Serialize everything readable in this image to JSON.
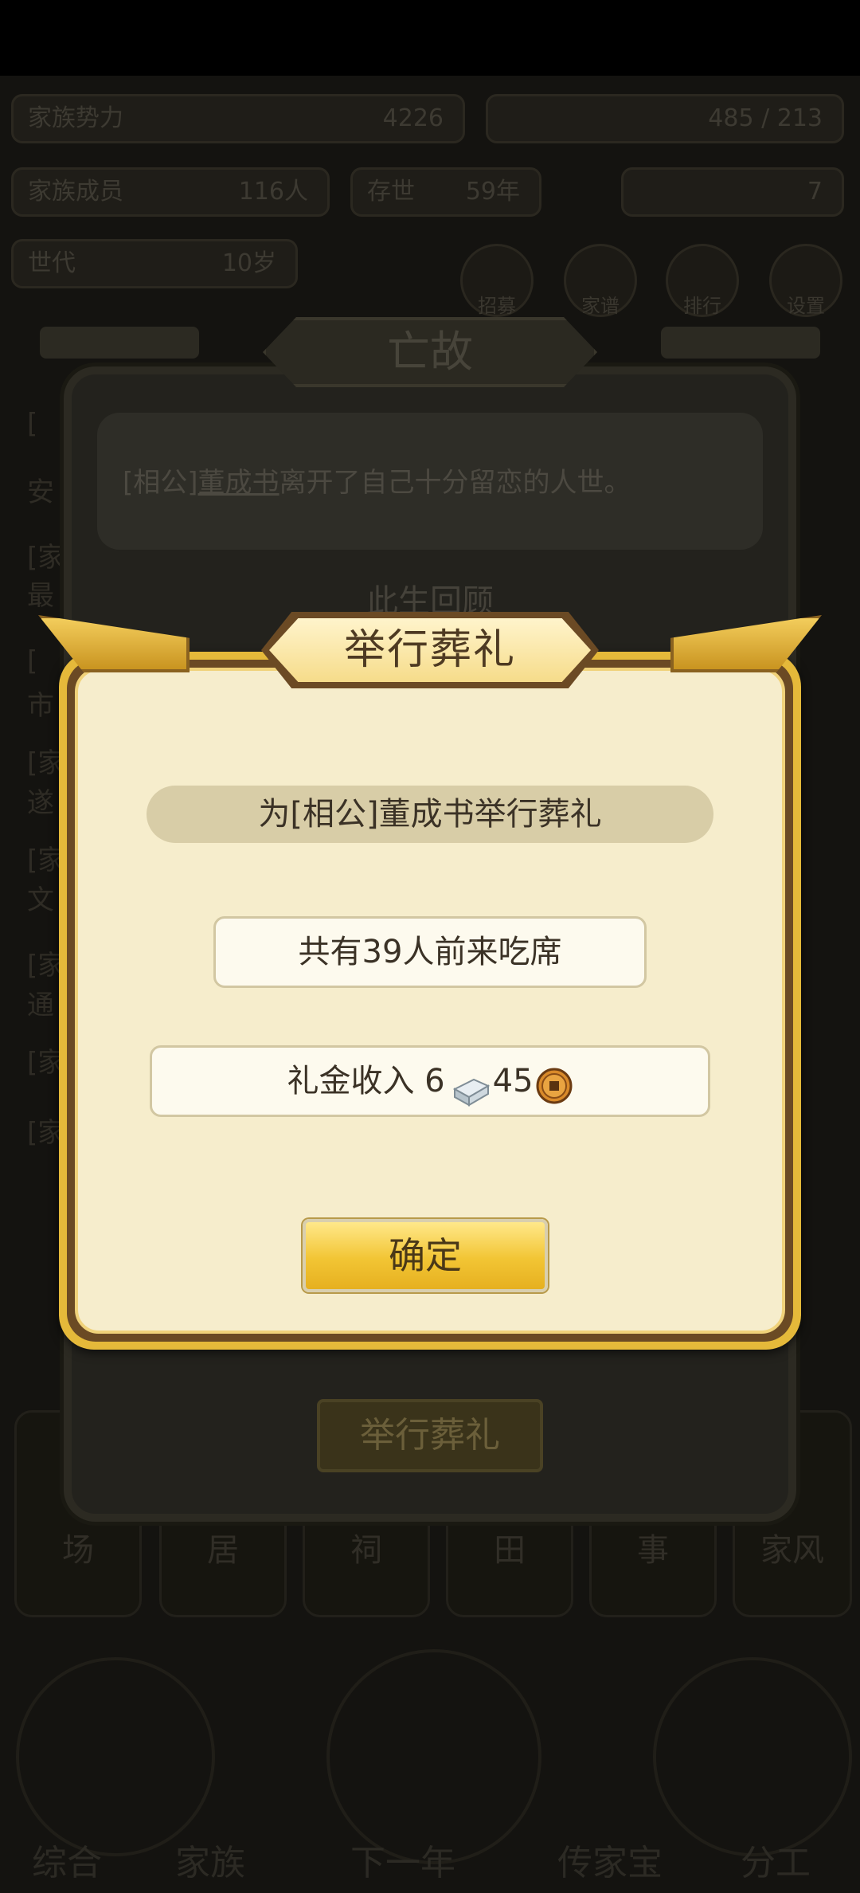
{
  "background": {
    "stats": [
      {
        "label": "家族势力",
        "value": "4226"
      },
      {
        "label": "",
        "value": "485 / 213"
      },
      {
        "label": "家族成员",
        "value": "116人"
      },
      {
        "label": "存世",
        "value": "59年"
      },
      {
        "label": "",
        "value": "7"
      },
      {
        "label": "世代",
        "value": "10岁"
      }
    ],
    "shortcuts": [
      "招募",
      "家谱",
      "排行",
      "设置"
    ],
    "log_lines": [
      "[",
      "安",
      "[家",
      "最",
      "[",
      "市",
      "[家",
      "遂",
      "[家",
      "文",
      "[家",
      "通",
      "[家",
      "[家"
    ],
    "tiles": [
      "场",
      "居",
      "祠",
      "田",
      "事",
      "家风"
    ],
    "bottom_nav": [
      "综合",
      "家族",
      "下一年",
      "传家宝",
      "分工"
    ]
  },
  "death_dialog": {
    "title": "亡故",
    "message_prefix": "[相公]",
    "message_name": "董成书",
    "message_suffix": "离开了自己十分留恋的人世。",
    "review_label": "此生回顾",
    "funeral_button": "举行葬礼"
  },
  "funeral_dialog": {
    "title": "举行葬礼",
    "subtitle": "为[相公]董成书举行葬礼",
    "guests": "共有39人前来吃席",
    "income_label": "礼金收入",
    "income_silver": "6",
    "income_copper": "45",
    "confirm_label": "确定",
    "colors": {
      "frame": "#e5b93a",
      "panel": "#f6edcc",
      "button": "#f2c534"
    }
  }
}
